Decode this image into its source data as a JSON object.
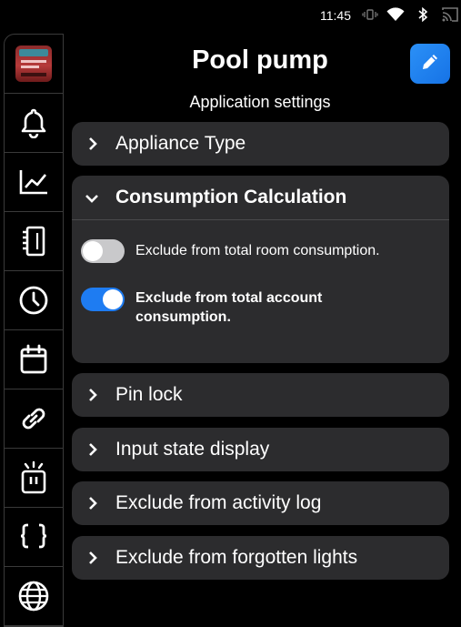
{
  "status_bar": {
    "time": "11:45",
    "icons": [
      "vibrate-icon",
      "wifi-icon",
      "bluetooth-icon",
      "cast-icon"
    ]
  },
  "sidebar": {
    "items": [
      {
        "name": "device-thumbnail"
      },
      {
        "icon": "bell-icon"
      },
      {
        "icon": "line-chart-icon"
      },
      {
        "icon": "log-book-icon"
      },
      {
        "icon": "clock-icon"
      },
      {
        "icon": "calendar-icon"
      },
      {
        "icon": "link-icon"
      },
      {
        "icon": "device-signal-icon"
      },
      {
        "icon": "code-braces-icon"
      },
      {
        "icon": "globe-icon"
      }
    ]
  },
  "header": {
    "title": "Pool pump",
    "subtitle": "Application settings",
    "edit_icon": "pencil-icon",
    "edit_color": "#1e7cf2"
  },
  "sections": {
    "appliance_type": {
      "label": "Appliance Type",
      "expanded": false
    },
    "consumption": {
      "label": "Consumption Calculation",
      "expanded": true,
      "options": [
        {
          "label": "Exclude from total room consumption.",
          "enabled": false
        },
        {
          "label": "Exclude from total account consumption.",
          "enabled": true
        }
      ]
    },
    "pin_lock": {
      "label": "Pin lock",
      "expanded": false
    },
    "input_state": {
      "label": "Input state display",
      "expanded": false
    },
    "activity_log": {
      "label": "Exclude from activity log",
      "expanded": false
    },
    "forgotten_lights": {
      "label": "Exclude from forgotten lights",
      "expanded": false
    }
  },
  "colors": {
    "background": "#000000",
    "card": "#2c2c2e",
    "accent": "#1e7cf2",
    "toggle_off": "#c9c9cb"
  }
}
